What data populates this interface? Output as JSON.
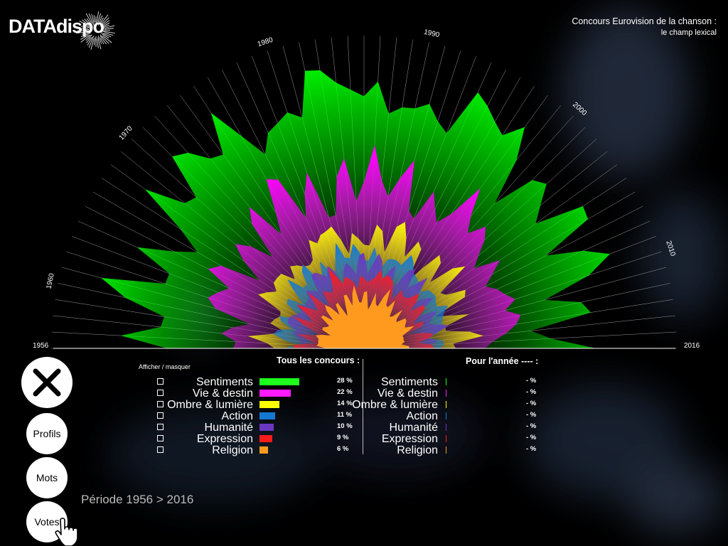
{
  "brand": {
    "logo_text": "DATAdispo"
  },
  "header": {
    "title_line1": "Concours Eurovision de la chanson :",
    "title_line2": "le champ lexical"
  },
  "chart_data": {
    "type": "radial-area",
    "year_range": [
      1956,
      2016
    ],
    "year_labels": [
      "1956",
      "1960",
      "1970",
      "1980",
      "1990",
      "2000",
      "2010",
      "2016"
    ],
    "stacking": "nested radial areas, from innermost (Religion) to outermost (Sentiments)",
    "series": [
      {
        "name": "Religion",
        "color": "#ff9a1f"
      },
      {
        "name": "Expression",
        "color": "#ff1a1a"
      },
      {
        "name": "Humanité",
        "color": "#6a38c0"
      },
      {
        "name": "Action",
        "color": "#1478d2"
      },
      {
        "name": "Ombre & lumière",
        "color": "#ffff00"
      },
      {
        "name": "Vie & destin",
        "color": "#ff00ff"
      },
      {
        "name": "Sentiments",
        "color": "#00ff00"
      }
    ]
  },
  "legend": {
    "toggle_label": "Afficher / masquer",
    "all_title": "Tous les concours :",
    "year_title": "Pour l'année ---- :",
    "items": [
      {
        "label": "Sentiments",
        "color": "#1dff1d",
        "value": 28,
        "pct_text": "28 %",
        "year_text": "- %"
      },
      {
        "label": "Vie & destin",
        "color": "#ff1aff",
        "value": 22,
        "pct_text": "22 %",
        "year_text": "- %"
      },
      {
        "label": "Ombre & lumière",
        "color": "#ffff00",
        "value": 14,
        "pct_text": "14 %",
        "year_text": "- %"
      },
      {
        "label": "Action",
        "color": "#1478d2",
        "value": 11,
        "pct_text": "11 %",
        "year_text": "- %"
      },
      {
        "label": "Humanité",
        "color": "#6a38c0",
        "value": 10,
        "pct_text": "10 %",
        "year_text": "- %"
      },
      {
        "label": "Expression",
        "color": "#ff1a1a",
        "value": 9,
        "pct_text": "9 %",
        "year_text": "- %"
      },
      {
        "label": "Religion",
        "color": "#ff9a1f",
        "value": 6,
        "pct_text": "6 %",
        "year_text": "- %"
      }
    ]
  },
  "nav": {
    "profils": "Profils",
    "mots": "Mots",
    "votes": "Votes"
  },
  "period": "Période 1956 > 2016"
}
